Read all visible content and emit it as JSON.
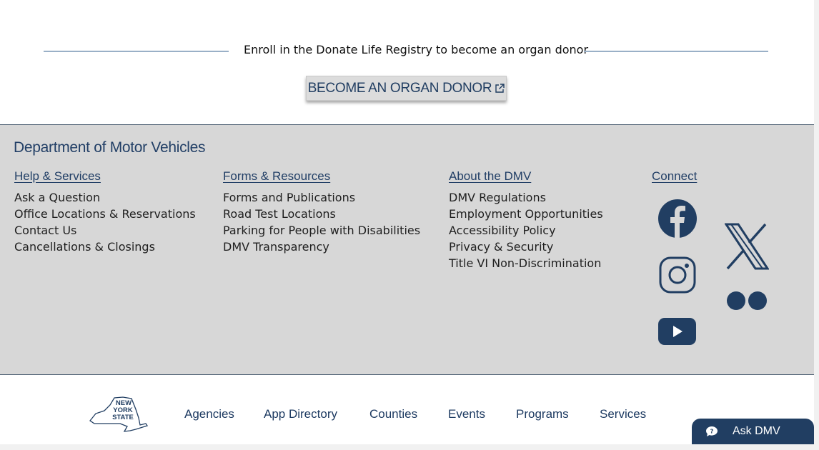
{
  "donor": {
    "text": "Enroll in the Donate Life Registry to become an organ donor",
    "button_label": "BECOME AN ORGAN DONOR",
    "button_icon": "external-link-icon"
  },
  "footer": {
    "department": "Department of Motor Vehicles",
    "columns": [
      {
        "heading": "Help & Services",
        "links": [
          "Ask a Question",
          "Office Locations & Reservations",
          "Contact Us",
          "Cancellations & Closings"
        ]
      },
      {
        "heading": "Forms & Resources",
        "links": [
          "Forms and Publications",
          "Road Test Locations",
          "Parking for People with Disabilities",
          "DMV Transparency"
        ]
      },
      {
        "heading": "About the DMV",
        "links": [
          "DMV Regulations",
          "Employment Opportunities",
          "Accessibility Policy",
          "Privacy & Security",
          "Title VI Non-Discrimination"
        ]
      }
    ],
    "connect": {
      "heading": "Connect",
      "icons": [
        "facebook-icon",
        "x-icon",
        "instagram-icon",
        "flickr-icon",
        "youtube-icon"
      ]
    }
  },
  "nys_bar": {
    "logo_text": [
      "NEW",
      "YORK",
      "STATE"
    ],
    "links": [
      "Agencies",
      "App Directory",
      "Counties",
      "Events",
      "Programs",
      "Services"
    ]
  },
  "ask_dmv": {
    "label": "Ask DMV",
    "icon": "chat-question-icon"
  },
  "colors": {
    "brand_navy": "#213e62",
    "footer_bg": "#d7d7d7",
    "button_bg": "#dcdcdc"
  }
}
